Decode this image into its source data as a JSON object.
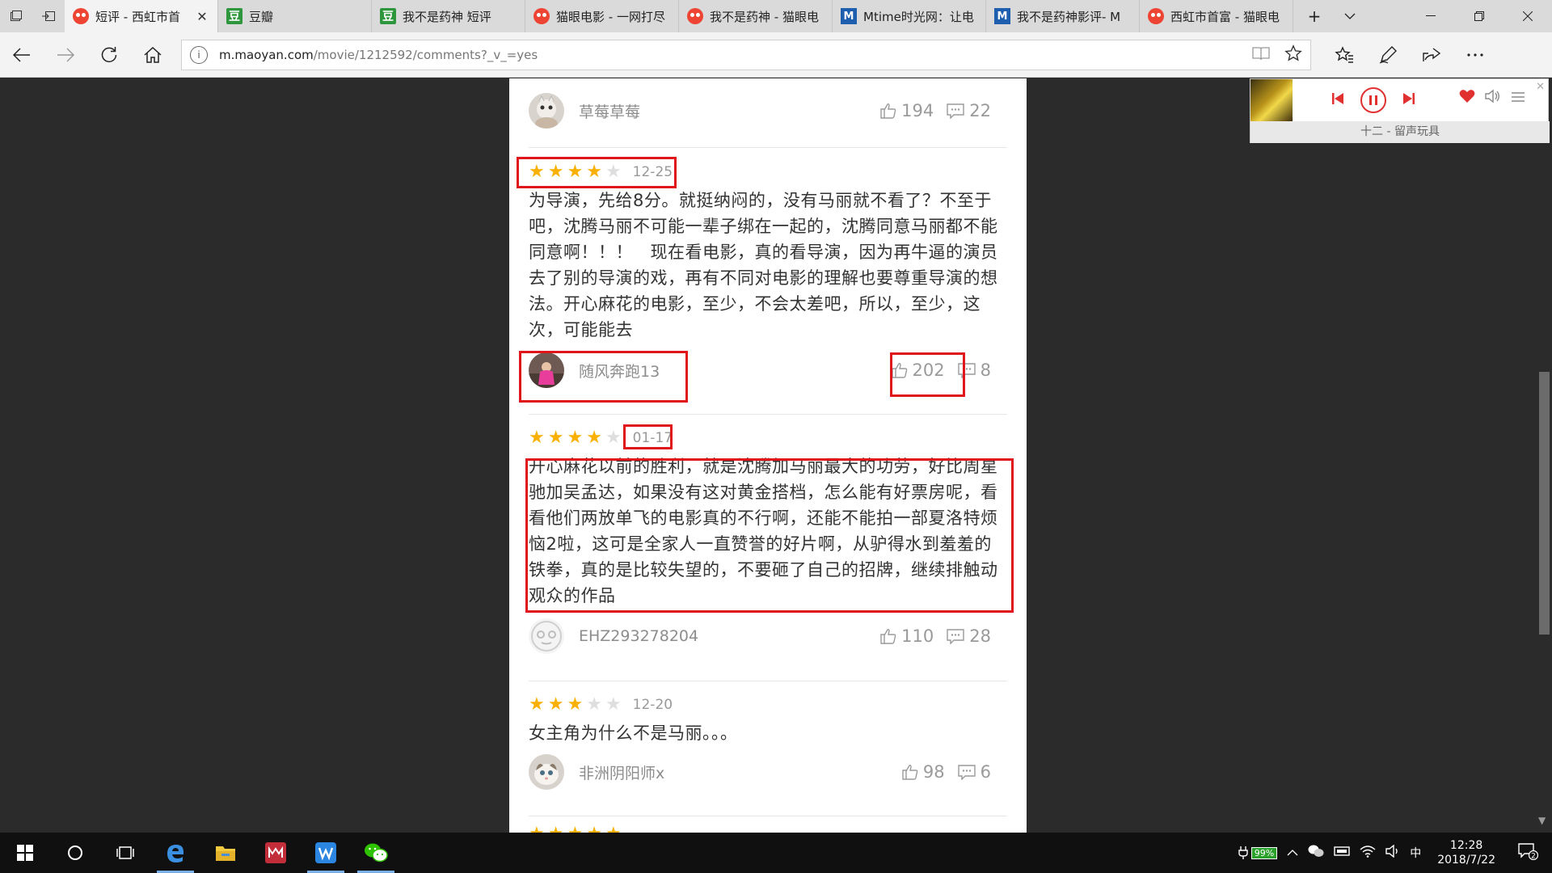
{
  "browser": {
    "tabs": [
      {
        "label": "短评 - 西虹市首",
        "favicon": "maoyan-icon",
        "active": true
      },
      {
        "label": "豆瓣",
        "favicon": "douban-icon",
        "active": false
      },
      {
        "label": "我不是药神 短评",
        "favicon": "douban-icon",
        "active": false
      },
      {
        "label": "猫眼电影 - 一网打尽",
        "favicon": "maoyan-icon",
        "active": false
      },
      {
        "label": "我不是药神 - 猫眼电",
        "favicon": "maoyan-icon",
        "active": false
      },
      {
        "label": "Mtime时光网：让电",
        "favicon": "mtime-icon",
        "active": false
      },
      {
        "label": "我不是药神影评- M",
        "favicon": "mtime-icon",
        "active": false
      },
      {
        "label": "西虹市首富 - 猫眼电",
        "favicon": "maoyan-icon",
        "active": false
      }
    ],
    "url_host": "m.maoyan.com",
    "url_path": "/movie/1212592/comments?_v_=yes"
  },
  "comments": [
    {
      "user": "草莓草莓",
      "likes": "194",
      "replies": "22",
      "stars": 0,
      "date": "",
      "text": ""
    },
    {
      "stars": 4,
      "date": "12-25",
      "text": "为导演，先给8分。就挺纳闷的，没有马丽就不看了？不至于吧，沈腾马丽不可能一辈子绑在一起的，沈腾同意马丽都不能同意啊！！！　现在看电影，真的看导演，因为再牛逼的演员去了别的导演的戏，再有不同对电影的理解也要尊重导演的想法。开心麻花的电影，至少，不会太差吧，所以，至少，这次，可能能去",
      "user": "随风奔跑13",
      "likes": "202",
      "replies": "8"
    },
    {
      "stars": 4,
      "date": "01-17",
      "text": "开心麻花以前的胜利，就是沈腾加马丽最大的功劳，好比周星驰加吴孟达，如果没有这对黄金搭档，怎么能有好票房呢，看看他们两放单飞的电影真的不行啊，还能不能拍一部夏洛特烦恼2啦，这可是全家人一直赞誉的好片啊，从驴得水到羞羞的铁拳，真的是比较失望的，不要砸了自己的招牌，继续排触动观众的作品",
      "user": "EHZ293278204",
      "likes": "110",
      "replies": "28"
    },
    {
      "stars": 3,
      "date": "12-20",
      "text": "女主角为什么不是马丽。。。",
      "user": "非洲阴阳师x",
      "likes": "98",
      "replies": "6"
    }
  ],
  "music_player": {
    "caption": "十二 - 留声玩具"
  },
  "taskbar": {
    "battery": "99%",
    "ime": "中",
    "time": "12:28",
    "date": "2018/7/22",
    "notifications": "2"
  },
  "colors": {
    "star": "#f9b000",
    "highlight": "#e0161b",
    "accent_red": "#e03030"
  }
}
